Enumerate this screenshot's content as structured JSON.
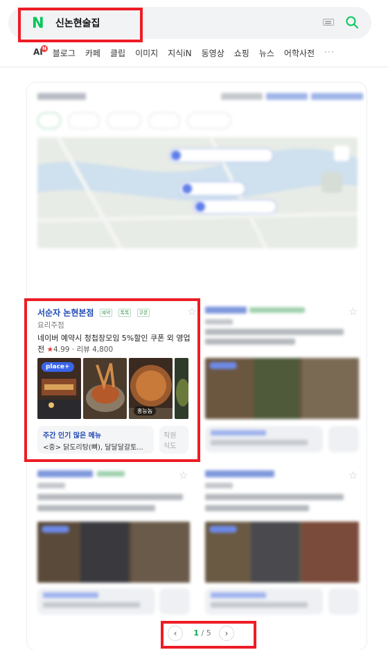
{
  "search": {
    "logo": "N",
    "query": "신논현술집"
  },
  "tabs": [
    {
      "label": "AI"
    },
    {
      "label": "블로그"
    },
    {
      "label": "카페"
    },
    {
      "label": "클립"
    },
    {
      "label": "이미지"
    },
    {
      "label": "지식iN"
    },
    {
      "label": "동영상"
    },
    {
      "label": "쇼핑"
    },
    {
      "label": "뉴스"
    },
    {
      "label": "어학사전"
    }
  ],
  "ai_badge": "N",
  "more_label": "···",
  "listing": {
    "name": "서순자 논현본점",
    "tags": [
      "예약",
      "톡톡",
      "쿠폰"
    ],
    "category": "요리주점",
    "promo": "네이버 예약시 청첩장모임 5%할인 쿠폰 외 영업 전",
    "rating": "4.99",
    "review_label": "리뷰 4,800",
    "photo_badge": "place+",
    "owner_badge": "홍능놈",
    "menu_title": "주간 인기 많은 메뉴",
    "menu_desc": "<중> 닭도리탕(뼈), 달달달갈토...",
    "side_box_text": "직원 식도"
  },
  "pagination": {
    "current": "1",
    "separator": "/",
    "total": "5",
    "prev": "‹",
    "next": "›"
  },
  "colors": {
    "brand_green": "#03c75a",
    "highlight_red": "#ee1c25",
    "link_blue": "#1e48b4"
  }
}
